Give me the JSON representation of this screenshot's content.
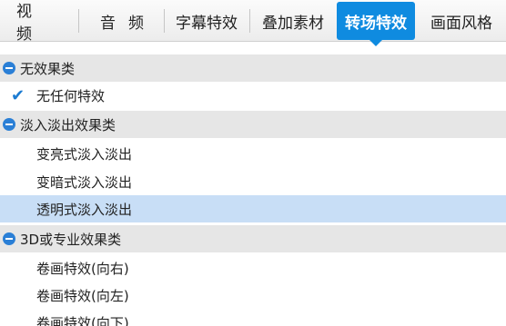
{
  "tabs": [
    {
      "label": "视频"
    },
    {
      "label": "音频"
    },
    {
      "label": "字幕特效"
    },
    {
      "label": "叠加素材"
    },
    {
      "label": "转场特效"
    },
    {
      "label": "画面风格"
    }
  ],
  "categories": [
    {
      "label": "无效果类",
      "items": [
        "无任何特效"
      ]
    },
    {
      "label": "淡入淡出效果类",
      "items": [
        "变亮式淡入淡出",
        "变暗式淡入淡出",
        "透明式淡入淡出"
      ]
    },
    {
      "label": "3D或专业效果类",
      "items": [
        "卷画特效(向右)",
        "卷画特效(向左)",
        "卷画特效(向下)"
      ]
    }
  ],
  "selected_item": "透明式淡入淡出",
  "colors": {
    "accent": "#0f8be0",
    "selected_row": "#c8def6",
    "category_row": "#e6e6e6"
  }
}
